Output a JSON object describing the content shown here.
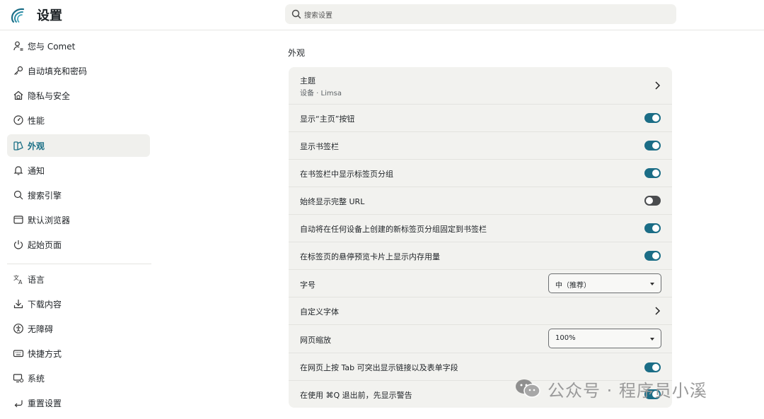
{
  "header": {
    "title": "设置",
    "search_placeholder": "搜索设置"
  },
  "sidebar": {
    "items": [
      {
        "label": "您与 Comet",
        "icon": "user-icon"
      },
      {
        "label": "自动填充和密码",
        "icon": "key-icon"
      },
      {
        "label": "隐私与安全",
        "icon": "home-shield-icon"
      },
      {
        "label": "性能",
        "icon": "gauge-icon"
      },
      {
        "label": "外观",
        "icon": "palette-icon",
        "active": true
      },
      {
        "label": "通知",
        "icon": "bell-icon"
      },
      {
        "label": "搜索引擎",
        "icon": "search-icon"
      },
      {
        "label": "默认浏览器",
        "icon": "browser-icon"
      },
      {
        "label": "起始页面",
        "icon": "power-icon"
      },
      {
        "label": "语言",
        "icon": "translate-icon"
      },
      {
        "label": "下载内容",
        "icon": "download-icon"
      },
      {
        "label": "无障碍",
        "icon": "accessibility-icon"
      },
      {
        "label": "快捷方式",
        "icon": "keyboard-icon"
      },
      {
        "label": "系统",
        "icon": "system-icon"
      },
      {
        "label": "重置设置",
        "icon": "reset-icon"
      }
    ]
  },
  "main": {
    "section_title": "外观",
    "rows": [
      {
        "label": "主题",
        "sub": "设备 · Limsa",
        "control": "chevron"
      },
      {
        "label": "显示“主页”按钮",
        "control": "toggle",
        "on": true
      },
      {
        "label": "显示书签栏",
        "control": "toggle",
        "on": true
      },
      {
        "label": "在书签栏中显示标签页分组",
        "control": "toggle",
        "on": true
      },
      {
        "label": "始终显示完整 URL",
        "control": "toggle",
        "on": false
      },
      {
        "label": "自动将在任何设备上创建的新标签页分组固定到书签栏",
        "control": "toggle",
        "on": true
      },
      {
        "label": "在标签页的悬停预览卡片上显示内存用量",
        "control": "toggle",
        "on": true
      },
      {
        "label": "字号",
        "control": "select",
        "value": "中（推荐）"
      },
      {
        "label": "自定义字体",
        "control": "chevron"
      },
      {
        "label": "网页缩放",
        "control": "select",
        "value": "100%"
      },
      {
        "label": "在网页上按 Tab 可突出显示链接以及表单字段",
        "control": "toggle",
        "on": true
      },
      {
        "label": "在使用 ⌘Q 退出前，先显示警告",
        "control": "toggle",
        "on": true
      }
    ]
  },
  "watermark": {
    "text": "公众号 · 程序员小溪"
  },
  "colors": {
    "accent": "#1b6d86",
    "panel_bg": "#f2f2ef",
    "toggle_off": "#4a4c4e"
  }
}
